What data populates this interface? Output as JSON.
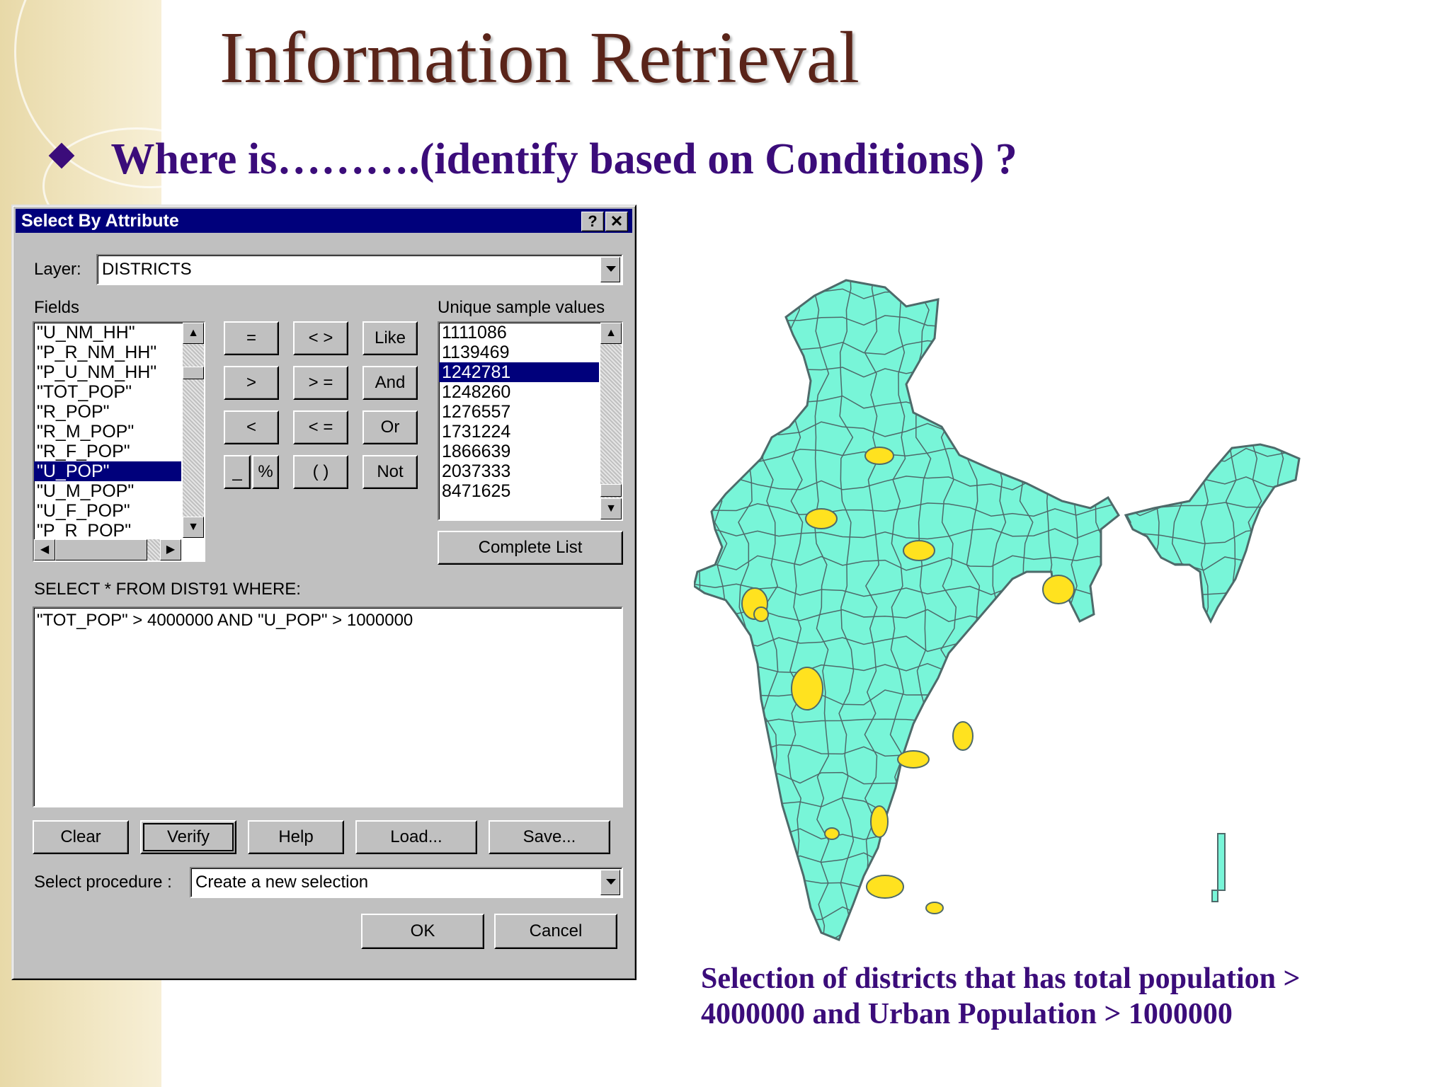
{
  "slide": {
    "title": "Information Retrieval",
    "bullet": "Where is……….(identify based on Conditions) ?",
    "caption_line1": "Selection of districts that has total population >",
    "caption_line2": "4000000 and Urban Population > 1000000"
  },
  "dialog": {
    "title": "Select By Attribute",
    "help_btn": "?",
    "close_btn": "✕",
    "layer_label": "Layer:",
    "layer_value": "DISTRICTS",
    "fields_label": "Fields",
    "fields": [
      "\"U_NM_HH\"",
      "\"P_R_NM_HH\"",
      "\"P_U_NM_HH\"",
      "\"TOT_POP\"",
      "\"R_POP\"",
      "\"R_M_POP\"",
      "\"R_F_POP\"",
      "\"U_POP\"",
      "\"U_M_POP\"",
      "\"U_F_POP\"",
      "\"P_R_POP\""
    ],
    "selected_field": "\"U_POP\"",
    "operators": {
      "eq": "=",
      "neq": "< >",
      "like": "Like",
      "gt": ">",
      "gte": "> =",
      "and": "And",
      "lt": "<",
      "lte": "< =",
      "or": "Or",
      "underscore": "_",
      "percent": "%",
      "parens": "( )",
      "not": "Not"
    },
    "unique_label": "Unique sample values",
    "unique_values": [
      "1111086",
      "1139469",
      "1242781",
      "1248260",
      "1276557",
      "1731224",
      "1866639",
      "2037333",
      "8471625"
    ],
    "selected_value": "1242781",
    "complete_list_btn": "Complete List",
    "sql_label": "SELECT * FROM DIST91 WHERE:",
    "sql_text": "\"TOT_POP\" > 4000000 AND \"U_POP\" > 1000000",
    "buttons": {
      "clear": "Clear",
      "verify": "Verify",
      "help": "Help",
      "load": "Load...",
      "save": "Save..."
    },
    "procedure_label": "Select procedure :",
    "procedure_value": "Create a new selection",
    "ok": "OK",
    "cancel": "Cancel"
  },
  "map": {
    "base_color": "#78f5d8",
    "border_color": "#4e6a6a",
    "highlight_color": "#ffe21f"
  }
}
